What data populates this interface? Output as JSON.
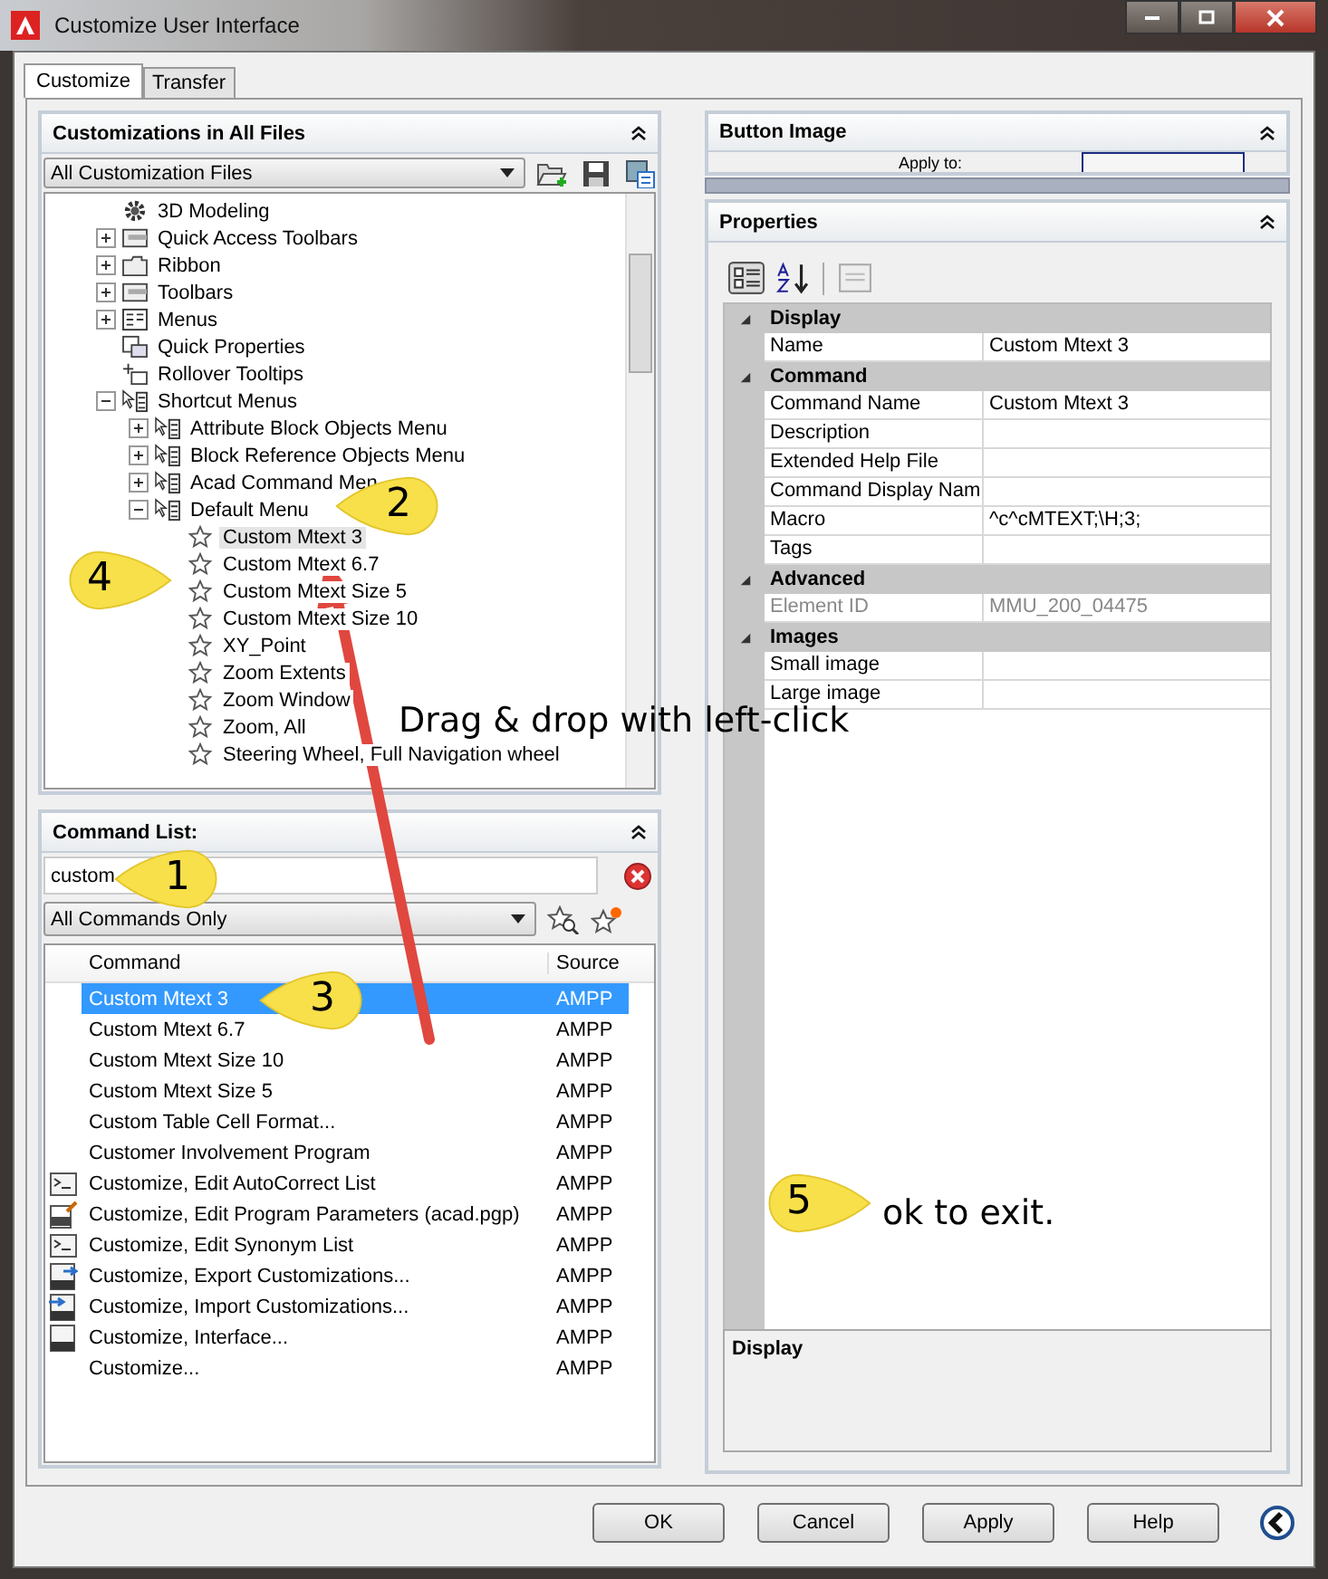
{
  "window": {
    "title": "Customize User Interface"
  },
  "tabs": [
    {
      "label": "Customize",
      "selected": true
    },
    {
      "label": "Transfer",
      "selected": false
    }
  ],
  "customizations_panel": {
    "title": "Customizations in All Files",
    "file_filter": "All Customization Files",
    "tree": [
      {
        "label": "3D Modeling",
        "kind": "gear",
        "selected": false
      },
      {
        "label": "Quick Access Toolbars",
        "kind": "toolbar",
        "expanded": false,
        "selected": false
      },
      {
        "label": "Ribbon",
        "kind": "ribbon",
        "expanded": false,
        "selected": false
      },
      {
        "label": "Toolbars",
        "kind": "toolbars",
        "expanded": false,
        "selected": false
      },
      {
        "label": "Menus",
        "kind": "menus",
        "expanded": false,
        "selected": false
      },
      {
        "label": "Quick Properties",
        "kind": "properties",
        "selected": false
      },
      {
        "label": "Rollover Tooltips",
        "kind": "tooltips",
        "selected": false
      },
      {
        "label": "Shortcut Menus",
        "kind": "shortcut",
        "expanded": true,
        "selected": false,
        "children": [
          {
            "label": "Attribute Block Objects Menu",
            "kind": "shortcut",
            "expanded": false,
            "selected": false
          },
          {
            "label": "Block Reference Objects Menu",
            "kind": "shortcut",
            "expanded": false,
            "selected": false
          },
          {
            "label": "Acad Command Men",
            "kind": "shortcut",
            "expanded": false,
            "selected": false
          },
          {
            "label": "Default Menu",
            "kind": "shortcut",
            "expanded": true,
            "selected": false,
            "children": [
              {
                "label": "Custom Mtext 3",
                "kind": "star",
                "selected": true
              },
              {
                "label": "Custom Mtext 6.7",
                "kind": "star",
                "selected": false
              },
              {
                "label": "Custom Mtext Size 5",
                "kind": "star",
                "selected": false
              },
              {
                "label": "Custom Mtext Size 10",
                "kind": "star",
                "selected": false
              },
              {
                "label": "XY_Point",
                "kind": "star",
                "selected": false
              },
              {
                "label": "Zoom Extents",
                "kind": "star",
                "selected": false
              },
              {
                "label": "Zoom Window",
                "kind": "star",
                "selected": false
              },
              {
                "label": "Zoom, All",
                "kind": "star",
                "selected": false
              },
              {
                "label": "Steering Wheel, Full Navigation wheel",
                "kind": "star",
                "selected": false
              }
            ]
          }
        ]
      }
    ]
  },
  "command_list": {
    "title": "Command List:",
    "search": {
      "value": "custom"
    },
    "filter": "All Commands Only",
    "columns": [
      "Command",
      "Source"
    ],
    "rows": [
      {
        "kind": "plain",
        "command": "Custom Mtext 3",
        "source": "AMPP",
        "selected": true
      },
      {
        "kind": "plain",
        "command": "Custom Mtext 6.7",
        "source": "AMPP",
        "selected": false
      },
      {
        "kind": "plain",
        "command": "Custom Mtext Size 10",
        "source": "AMPP",
        "selected": false
      },
      {
        "kind": "plain",
        "command": "Custom Mtext Size 5",
        "source": "AMPP",
        "selected": false
      },
      {
        "kind": "plain",
        "command": "Custom Table Cell Format...",
        "source": "AMPP",
        "selected": false
      },
      {
        "kind": "plain",
        "command": "Customer Involvement Program",
        "source": "AMPP",
        "selected": false
      },
      {
        "kind": "console",
        "command": "Customize, Edit AutoCorrect List",
        "source": "AMPP",
        "selected": false
      },
      {
        "kind": "pgp",
        "command": "Customize, Edit Program Parameters (acad.pgp)",
        "source": "AMPP",
        "selected": false
      },
      {
        "kind": "console",
        "command": "Customize, Edit Synonym List",
        "source": "AMPP",
        "selected": false
      },
      {
        "kind": "export",
        "command": "Customize, Export Customizations...",
        "source": "AMPP",
        "selected": false
      },
      {
        "kind": "import",
        "command": "Customize, Import Customizations...",
        "source": "AMPP",
        "selected": false
      },
      {
        "kind": "interface",
        "command": "Customize, Interface...",
        "source": "AMPP",
        "selected": false
      },
      {
        "kind": "plain",
        "command": "Customize...",
        "source": "AMPP",
        "selected": false
      }
    ]
  },
  "button_image_panel": {
    "title": "Button Image",
    "apply_to_label": "Apply to:"
  },
  "properties_panel": {
    "title": "Properties",
    "categories": [
      {
        "name": "Display",
        "expanded": true,
        "rows": [
          {
            "name": "Name",
            "value": "Custom Mtext 3",
            "disabled": false
          }
        ]
      },
      {
        "name": "Command",
        "expanded": true,
        "rows": [
          {
            "name": "Command Name",
            "value": "Custom Mtext 3",
            "disabled": false
          },
          {
            "name": "Description",
            "disabled": false
          },
          {
            "name": "Extended Help File",
            "disabled": false
          },
          {
            "name": "Command Display Nam",
            "disabled": false
          },
          {
            "name": "Macro",
            "value": "^c^cMTEXT;\\H;3;",
            "disabled": false
          },
          {
            "name": "Tags",
            "disabled": false
          }
        ]
      },
      {
        "name": "Advanced",
        "expanded": true,
        "rows": [
          {
            "name": "Element ID",
            "value": "MMU_200_04475",
            "disabled": true
          }
        ]
      },
      {
        "name": "Images",
        "expanded": true,
        "rows": [
          {
            "name": "Small image",
            "disabled": false
          },
          {
            "name": "Large image",
            "disabled": false
          }
        ]
      }
    ],
    "description_title": "Display"
  },
  "buttons": [
    "OK",
    "Cancel",
    "Apply",
    "Help"
  ],
  "annotations": {
    "callouts": [
      {
        "number": "1",
        "kind": "left"
      },
      {
        "number": "2",
        "kind": "left"
      },
      {
        "number": "3",
        "kind": "left"
      },
      {
        "number": "4",
        "kind": "right"
      },
      {
        "number": "5",
        "kind": "right"
      }
    ],
    "notes": [
      "Drag & drop with left-click",
      "ok to exit."
    ]
  }
}
